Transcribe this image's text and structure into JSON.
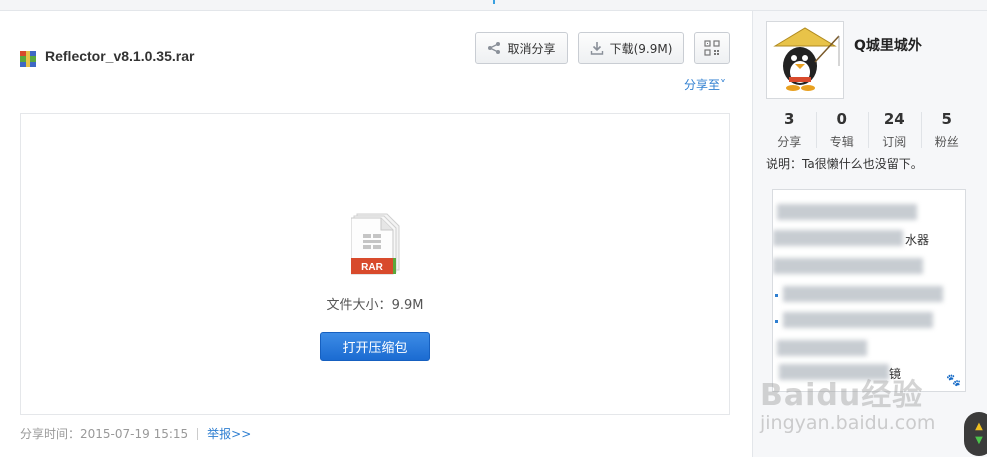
{
  "file": {
    "name": "Reflector_v8.1.0.35.rar",
    "size_label": "文件大小：",
    "size_value": "9.9M",
    "type_badge": "RAR"
  },
  "toolbar": {
    "cancel_share_label": "取消分享",
    "download_label": "下载(9.9M)",
    "share_to_label": "分享至"
  },
  "preview": {
    "open_button_label": "打开压缩包"
  },
  "meta": {
    "share_time_label": "分享时间：",
    "share_time_value": "2015-07-19 15:15",
    "report_label": "举报>>"
  },
  "profile": {
    "username": "Q城里城外",
    "stats": [
      {
        "value": "3",
        "label": "分享"
      },
      {
        "value": "0",
        "label": "专辑"
      },
      {
        "value": "24",
        "label": "订阅"
      },
      {
        "value": "5",
        "label": "粉丝"
      }
    ],
    "description": "说明：Ta很懒什么也没留下。"
  },
  "list": {
    "visible_fragments": [
      "水器",
      "镜"
    ]
  },
  "watermark": {
    "brand": "Baidu经验",
    "url": "jingyan.baidu.com"
  },
  "colors": {
    "link": "#2f7fd1",
    "primary_button": "#1b6bd1",
    "rar_badge": "#d84a2c"
  }
}
